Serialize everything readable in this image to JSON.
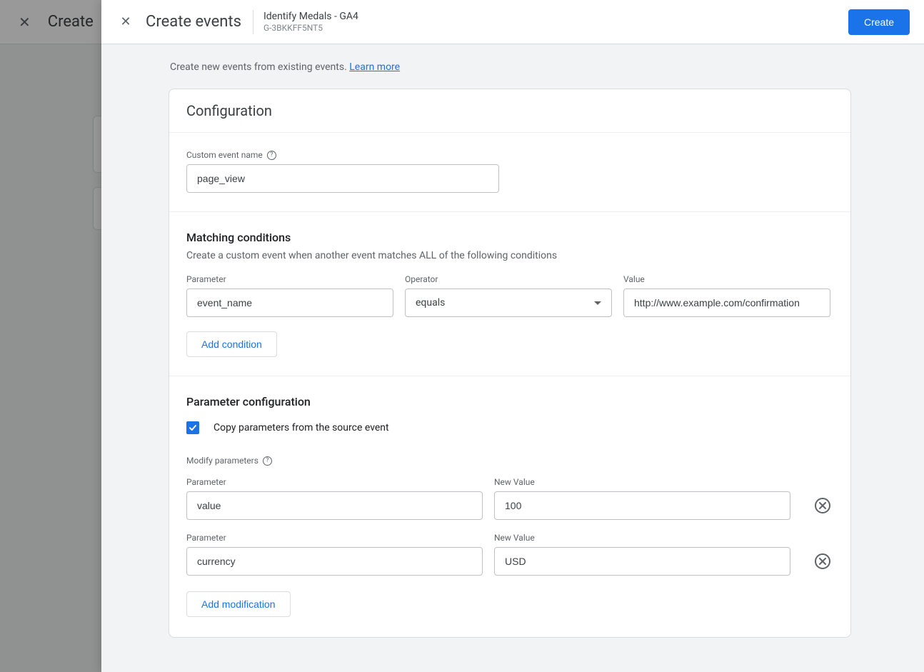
{
  "background": {
    "title": "Create"
  },
  "panel": {
    "title": "Create events",
    "propertyName": "Identify Medals - GA4",
    "propertyId": "G-3BKKFF5NT5",
    "createButton": "Create"
  },
  "intro": {
    "text": "Create new events from existing events. ",
    "link": "Learn more"
  },
  "card": {
    "title": "Configuration",
    "customEventLabel": "Custom event name",
    "customEventValue": "page_view",
    "matchingTitle": "Matching conditions",
    "matchingSub": "Create a custom event when another event matches ALL of the following conditions",
    "condition": {
      "paramLabel": "Parameter",
      "paramValue": "event_name",
      "opLabel": "Operator",
      "opValue": "equals",
      "valLabel": "Value",
      "valValue": "http://www.example.com/confirmation"
    },
    "addCondition": "Add condition",
    "paramConfigTitle": "Parameter configuration",
    "copyParams": "Copy parameters from the source event",
    "modifyLabel": "Modify parameters",
    "mods": [
      {
        "paramLabel": "Parameter",
        "param": "value",
        "valLabel": "New Value",
        "val": "100"
      },
      {
        "paramLabel": "Parameter",
        "param": "currency",
        "valLabel": "New Value",
        "val": "USD"
      }
    ],
    "addModification": "Add modification"
  }
}
